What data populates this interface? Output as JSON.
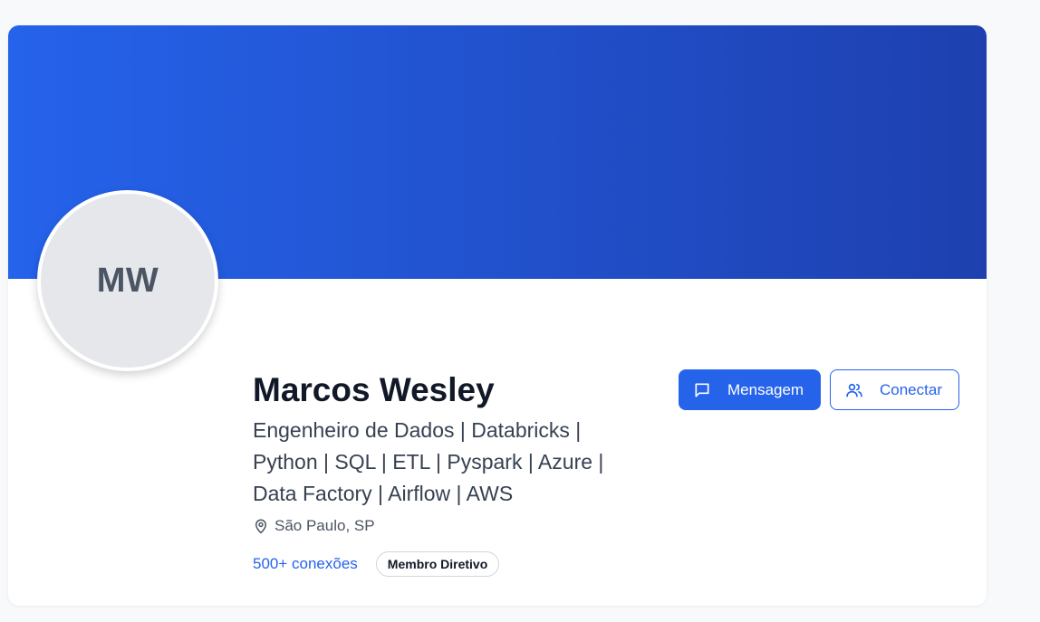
{
  "profile": {
    "initials": "MW",
    "name": "Marcos Wesley",
    "headline": "Engenheiro de Dados | Databricks | Python | SQL | ETL | Pyspark | Azure | Data Factory | Airflow | AWS",
    "location": "São Paulo, SP",
    "connections": "500+ conexões",
    "badge": "Membro Diretivo"
  },
  "actions": {
    "message_label": "Mensagem",
    "connect_label": "Conectar"
  },
  "icons": {
    "message": "chat-bubble-icon",
    "connect": "users-icon",
    "location": "map-pin-icon"
  },
  "colors": {
    "banner_start": "#2563eb",
    "banner_end": "#1e40af",
    "accent": "#2563eb"
  }
}
